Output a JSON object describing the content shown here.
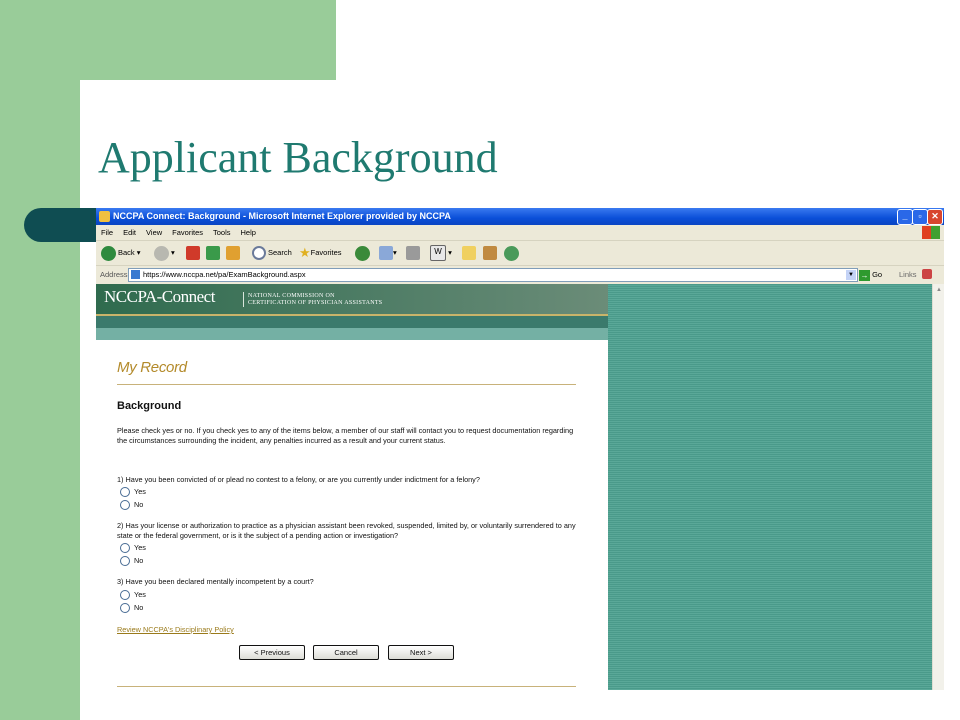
{
  "slide": {
    "title": "Applicant Background"
  },
  "window": {
    "title": "NCCPA Connect: Background - Microsoft Internet Explorer provided by NCCPA",
    "minimize": "_",
    "maximize": "▫",
    "close": "✕"
  },
  "menu": [
    "File",
    "Edit",
    "View",
    "Favorites",
    "Tools",
    "Help"
  ],
  "toolbar": {
    "back_label": "Back",
    "search_label": "Search",
    "favorites_label": "Favorites"
  },
  "address": {
    "label": "Address",
    "url": "https://www.nccpa.net/pa/ExamBackground.aspx",
    "go_label": "Go",
    "links_label": "Links"
  },
  "header": {
    "logo": "NCCPA-Connect",
    "org_line1": "NATIONAL COMMISSION ON",
    "org_line2": "CERTIFICATION OF PHYSICIAN ASSISTANTS"
  },
  "content": {
    "section_title": "My Record",
    "heading": "Background",
    "intro": "Please check yes or no. If you check yes to any of the items below, a member of our staff will contact you to request documentation regarding the circumstances surrounding the incident, any penalties incurred as a result and your current status.",
    "questions": [
      {
        "text": "1) Have you been convicted of or plead no contest to a felony, or are you currently under indictment for a felony?",
        "yes": "Yes",
        "no": "No"
      },
      {
        "text": "2) Has your license or authorization to practice as a physician assistant been revoked, suspended, limited by, or voluntarily surrendered to any state or the federal government, or is it the subject of a pending action or investigation?",
        "yes": "Yes",
        "no": "No"
      },
      {
        "text": "3) Have you been declared mentally incompetent by a court?",
        "yes": "Yes",
        "no": "No"
      }
    ],
    "policy_link": "Review NCCPA's Disciplinary Policy",
    "buttons": {
      "previous": "< Previous",
      "cancel": "Cancel",
      "next": "Next >"
    }
  },
  "colors": {
    "title_teal": "#1f7a70",
    "slide_green": "#99cc99",
    "xp_blue": "#0a4fd8",
    "record_gold": "#b38a2a"
  }
}
